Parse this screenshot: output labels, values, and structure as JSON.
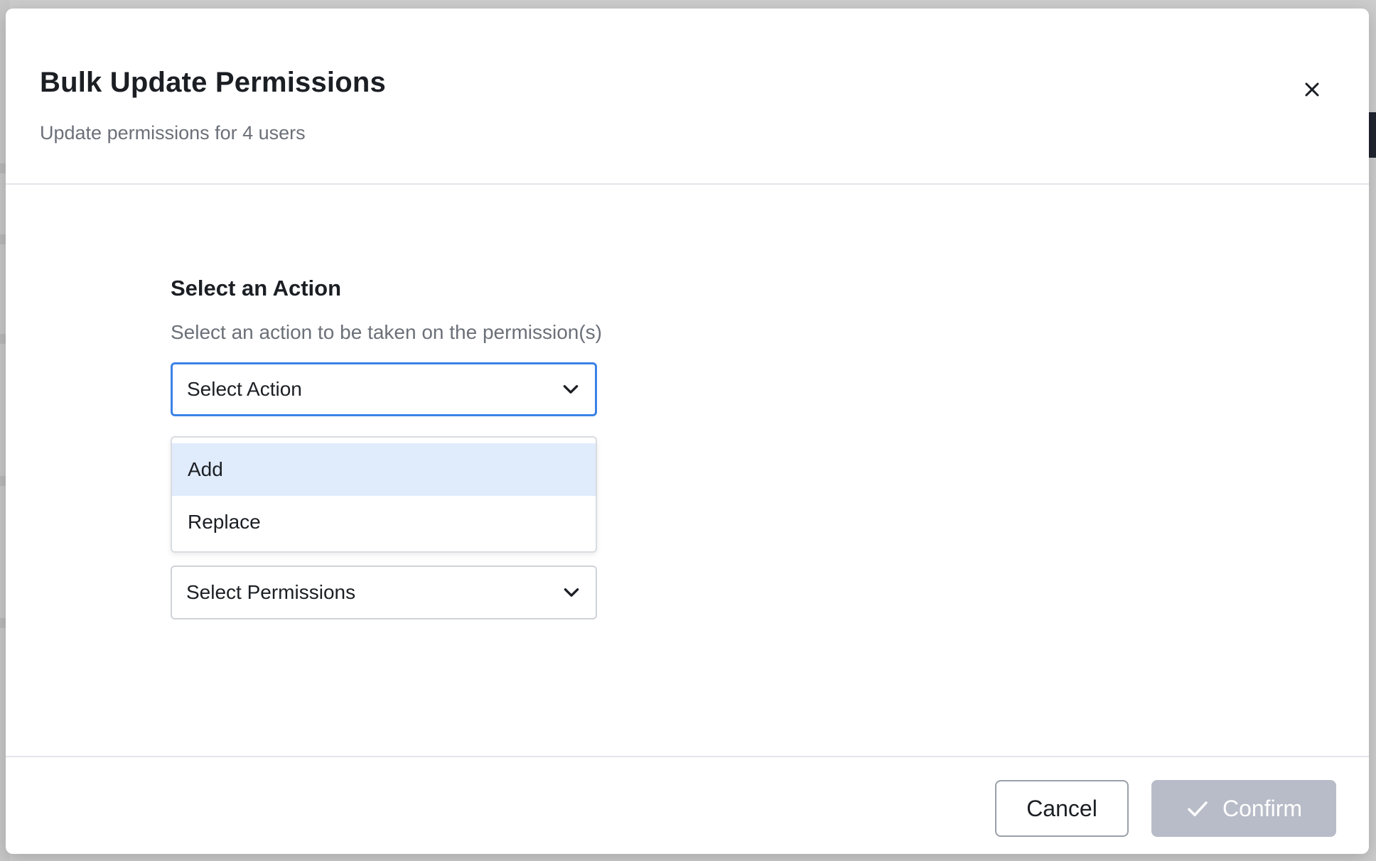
{
  "modal": {
    "title": "Bulk Update Permissions",
    "subtitle": "Update permissions for 4 users",
    "close_icon": "close-icon"
  },
  "action_section": {
    "title": "Select an Action",
    "description": "Select an action to be taken on the permission(s)",
    "action_select": {
      "value": "Select Action",
      "options": [
        "Add",
        "Replace"
      ],
      "highlighted_option": "Add"
    },
    "permissions_select": {
      "value": "Select Permissions"
    }
  },
  "footer": {
    "cancel_label": "Cancel",
    "confirm_label": "Confirm",
    "confirm_icon": "check-icon"
  },
  "colors": {
    "focus_border": "#3b82e6",
    "option_highlight": "#e0ebfc",
    "confirm_disabled": "#b8bcc8"
  }
}
